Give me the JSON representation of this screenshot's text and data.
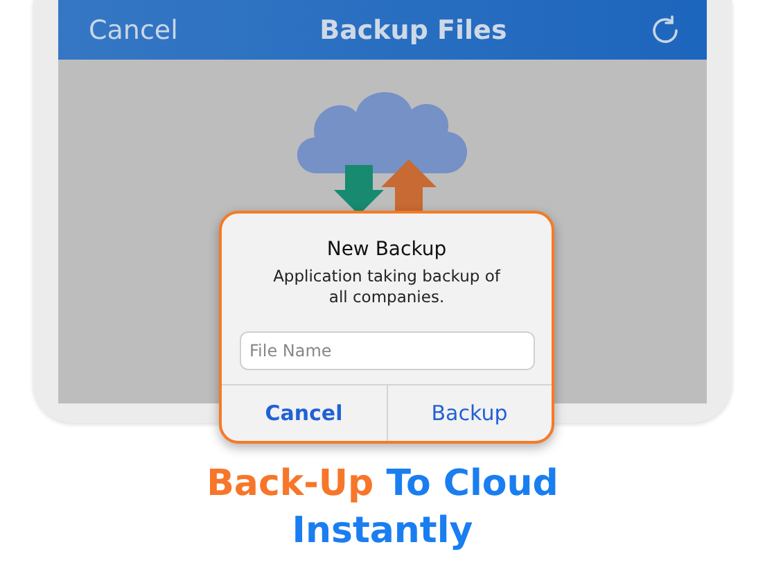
{
  "navbar": {
    "left_button": "Cancel",
    "title": "Backup Files"
  },
  "dialog": {
    "title": "New Backup",
    "message": "Application taking backup of all companies.",
    "field": {
      "placeholder": "File Name"
    },
    "buttons": [
      {
        "label": "Cancel",
        "kind": "cancel"
      },
      {
        "label": "Backup",
        "kind": "default"
      }
    ]
  },
  "headline": {
    "lines": [
      {
        "parts": [
          {
            "text": "Back-Up",
            "color": "#f7762a"
          },
          {
            "text": "To Cloud",
            "color": "#1a7ef0"
          }
        ]
      },
      {
        "parts": [
          {
            "text": "Instantly",
            "color": "#1a7ef0"
          }
        ]
      }
    ]
  }
}
